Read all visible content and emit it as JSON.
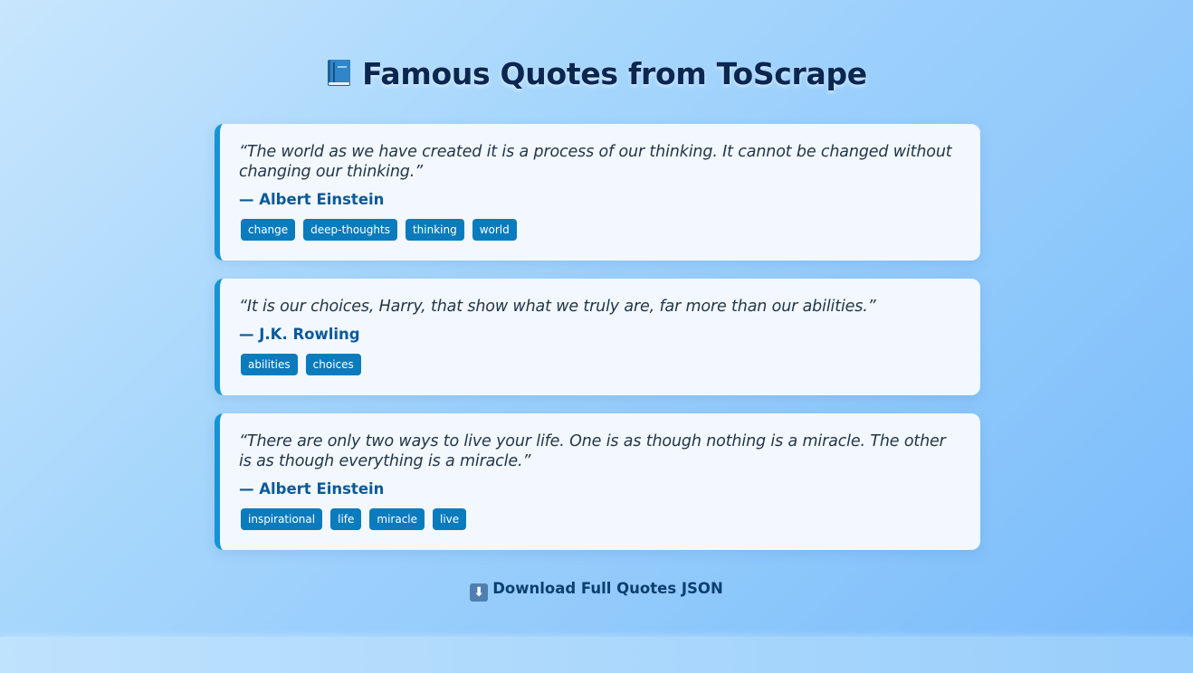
{
  "header": {
    "title": "Famous Quotes from ToScrape",
    "icon": "book-icon"
  },
  "quotes": [
    {
      "text": "“The world as we have created it is a process of our thinking. It cannot be changed without changing our thinking.”",
      "author": "— Albert Einstein",
      "tags": [
        "change",
        "deep-thoughts",
        "thinking",
        "world"
      ]
    },
    {
      "text": "“It is our choices, Harry, that show what we truly are, far more than our abilities.”",
      "author": "— J.K. Rowling",
      "tags": [
        "abilities",
        "choices"
      ]
    },
    {
      "text": "“There are only two ways to live your life. One is as though nothing is a miracle. The other is as though everything is a miracle.”",
      "author": "— Albert Einstein",
      "tags": [
        "inspirational",
        "life",
        "miracle",
        "live"
      ]
    }
  ],
  "footer": {
    "download_label": "Download Full Quotes JSON",
    "download_icon": "down-arrow-icon",
    "download_icon_glyph": "⬇"
  },
  "colors": {
    "accent": "#1694d4",
    "tag_bg": "#0a7bbd",
    "title": "#0b2650",
    "author": "#0b5a9a"
  }
}
